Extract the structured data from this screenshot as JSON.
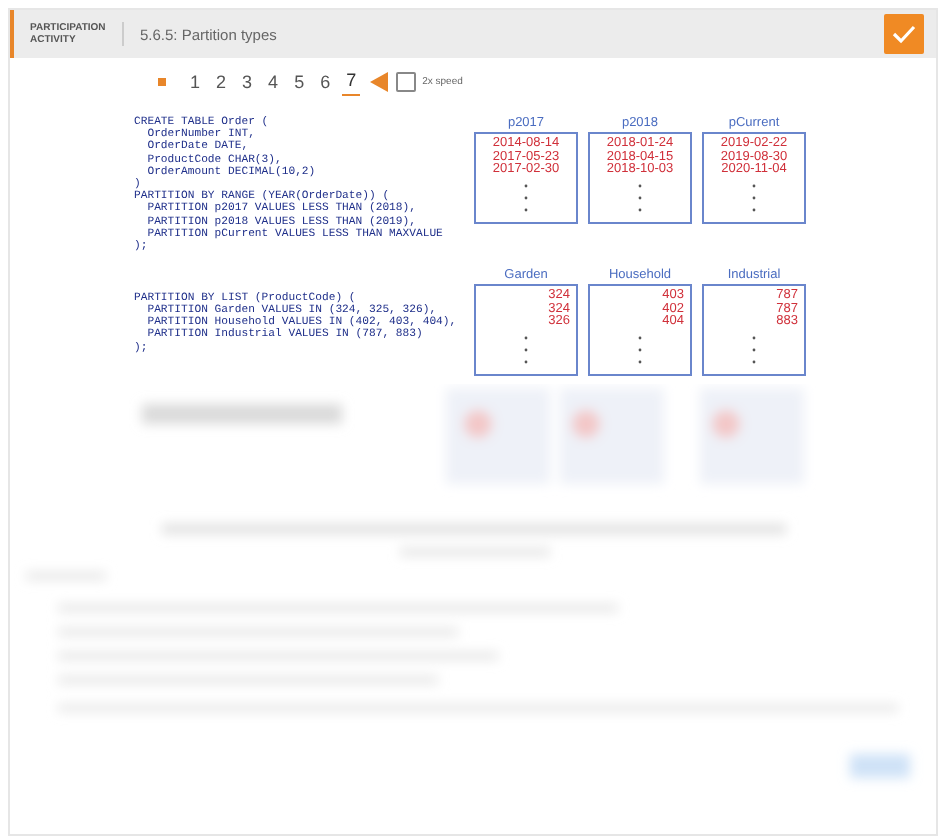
{
  "header": {
    "label": "PARTICIPATION ACTIVITY",
    "title": "5.6.5: Partition types",
    "completed": true
  },
  "steps": [
    {
      "label": "1",
      "selected": false
    },
    {
      "label": "2",
      "selected": false
    },
    {
      "label": "3",
      "selected": false
    },
    {
      "label": "4",
      "selected": false
    },
    {
      "label": "5",
      "selected": false
    },
    {
      "label": "6",
      "selected": false
    },
    {
      "label": "7",
      "selected": true
    }
  ],
  "speed": {
    "label": "2x speed",
    "checked": false
  },
  "sections": [
    {
      "kind": "range",
      "code": [
        "CREATE TABLE Order (",
        "  OrderNumber INT,",
        "  OrderDate DATE,",
        "  ProductCode CHAR(3),",
        "  OrderAmount DECIMAL(10,2)",
        ")",
        "PARTITION BY RANGE (YEAR(OrderDate)) (",
        "  PARTITION p2017 VALUES LESS THAN (2018),",
        "  PARTITION p2018 VALUES LESS THAN (2019),",
        "  PARTITION pCurrent VALUES LESS THAN MAXVALUE",
        ");"
      ],
      "partitions": [
        {
          "name": "p2017",
          "values": [
            "2014-08-14",
            "2017-05-23",
            "2017-02-30"
          ]
        },
        {
          "name": "p2018",
          "values": [
            "2018-01-24",
            "2018-04-15",
            "2018-10-03"
          ]
        },
        {
          "name": "pCurrent",
          "values": [
            "2019-02-22",
            "2019-08-30",
            "2020-11-04"
          ]
        }
      ]
    },
    {
      "kind": "list",
      "code": [
        "PARTITION BY LIST (ProductCode) (",
        "  PARTITION Garden VALUES IN (324, 325, 326),",
        "  PARTITION Household VALUES IN (402, 403, 404),",
        "  PARTITION Industrial VALUES IN (787, 883)",
        ");"
      ],
      "partitions": [
        {
          "name": "Garden",
          "values": [
            "324",
            "324",
            "326"
          ]
        },
        {
          "name": "Household",
          "values": [
            "403",
            "402",
            "404"
          ]
        },
        {
          "name": "Industrial",
          "values": [
            "787",
            "787",
            "883"
          ]
        }
      ]
    }
  ]
}
